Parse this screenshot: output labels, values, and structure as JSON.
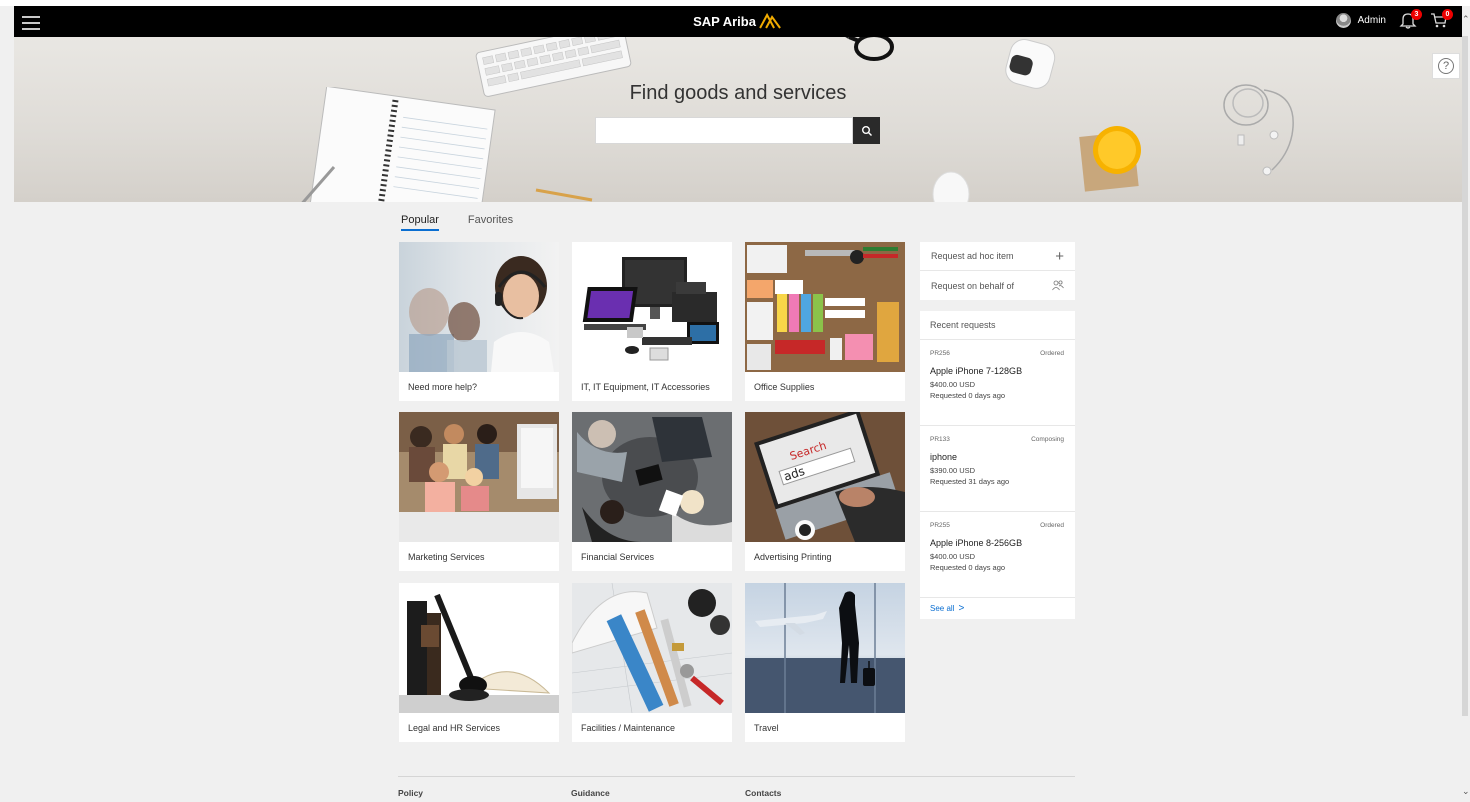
{
  "header": {
    "brand": "SAP Ariba",
    "user_name": "Admin",
    "notifications_count": "3",
    "cart_count": "0"
  },
  "banner": {
    "title": "Find goods and services",
    "search_placeholder": "",
    "search_value": ""
  },
  "tabs": [
    {
      "label": "Popular",
      "active": true
    },
    {
      "label": "Favorites",
      "active": false
    }
  ],
  "tiles": [
    {
      "label": "Need more help?"
    },
    {
      "label": "IT, IT Equipment, IT Accessories"
    },
    {
      "label": "Office Supplies"
    },
    {
      "label": "Marketing Services"
    },
    {
      "label": "Financial Services"
    },
    {
      "label": "Advertising Printing"
    },
    {
      "label": "Legal and HR Services"
    },
    {
      "label": "Facilities / Maintenance"
    },
    {
      "label": "Travel"
    }
  ],
  "side_actions": {
    "ad_hoc": "Request ad hoc item",
    "on_behalf": "Request on behalf of"
  },
  "recent_requests": {
    "title": "Recent requests",
    "items": [
      {
        "id": "PR256",
        "status": "Ordered",
        "name": "Apple iPhone 7-128GB",
        "price": "$400.00 USD",
        "when": "Requested 0 days ago"
      },
      {
        "id": "PR133",
        "status": "Composing",
        "name": "iphone",
        "price": "$390.00 USD",
        "when": "Requested 31 days ago"
      },
      {
        "id": "PR255",
        "status": "Ordered",
        "name": "Apple iPhone 8-256GB",
        "price": "$400.00 USD",
        "when": "Requested 0 days ago"
      }
    ],
    "see_all": "See all"
  },
  "footer": {
    "policy": "Policy",
    "guidance": "Guidance",
    "contacts": "Contacts"
  },
  "icons": {
    "menu": "hamburger-icon",
    "search": "search-icon",
    "bell": "bell-icon",
    "cart": "cart-icon",
    "help": "help-icon",
    "plus": "plus-icon",
    "users": "users-icon",
    "chevron": "chevron-right-icon"
  },
  "colors": {
    "header_bg": "#000000",
    "brand_accent": "#f0ab00",
    "link": "#0a6ed1",
    "badge": "#e00000"
  }
}
